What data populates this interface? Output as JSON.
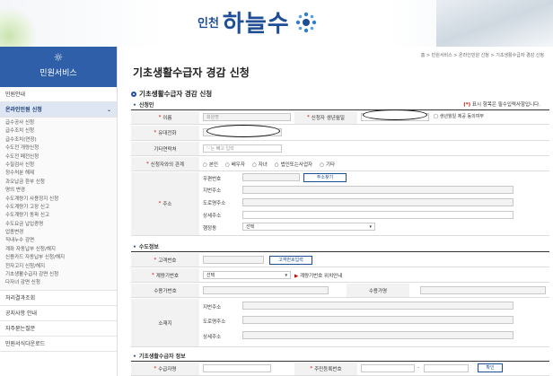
{
  "header": {
    "logo_small": "인천",
    "logo_big": "하늘수"
  },
  "sidebar": {
    "title": "민원서비스",
    "items": [
      {
        "label": "민원안내"
      },
      {
        "label": "온라인민원 신청",
        "icon": "chevron-down-icon"
      },
      {
        "label": "처리결과조회"
      },
      {
        "label": "공지사항 안내"
      },
      {
        "label": "자주묻는질문"
      },
      {
        "label": "민원서식다운로드"
      }
    ],
    "sub_items": [
      "급수공사 신청",
      "급수조치 신청",
      "급수조치(연장)",
      "수도전 개량신청",
      "수도전 폐전신청",
      "수질검사 신청",
      "정수처분 해제",
      "과오납금 환부 신청",
      "명의 변경",
      "수도계량기 사용정지 신청",
      "수도계량기 고장 신고",
      "수도계량기 동파 신고",
      "수도요금 납입증명",
      "업종변경",
      "직내누수 감면",
      "계좌 자동납부 신청/해지",
      "신용카드 자동납부 신청/해지",
      "전자고지 신청/해지",
      "기초생활수급자 감면 신청",
      "다자녀 감면 신청"
    ]
  },
  "breadcrumb": "홈 > 민원서비스 > 온라인민원 신청 > 기초생활수급자 경감 신청",
  "page_title": "기초생활수급자 경감 신청",
  "section_title": "기초생활수급자 경감 신청",
  "required_note": {
    "mark": "(*)",
    "text": " 표시 항목은 필수입력사항입니다."
  },
  "applicant": {
    "header": "신청인",
    "name_label": "이름",
    "name_value": "회원명",
    "birth_label": "신청자 생년월일",
    "birth_consent": "생년월일 제공 동의여부",
    "phone_label": "유대전화",
    "other_label": "기타연락처",
    "other_placeholder": "'-'는 빼고 입력",
    "relation_label": "신청자와의 관계",
    "relation_options": [
      "본인",
      "배우자",
      "자녀",
      "법인또는사업자",
      "기타"
    ],
    "addr_label": "주소",
    "zip_label": "우편번호",
    "zip_button": "주소찾기",
    "jibun_label": "지번주소",
    "road_label": "도로명주소",
    "detail_label": "상세주소",
    "dong_label": "행정동",
    "dong_value": "선택"
  },
  "water": {
    "header": "수도정보",
    "cust_label": "고객번호",
    "cust_button": "고객번호입력",
    "meter_label": "계량기번호",
    "meter_value": "선택",
    "meter_note": "계량기번호 위치안내",
    "user_no_label": "수용가번호",
    "user_type_label": "수용가명",
    "loc_label": "소재지",
    "jibun_label": "지번주소",
    "road_label": "도로명주소",
    "detail_label": "상세주소"
  },
  "recipient": {
    "header": "기초생활수급자 정보",
    "name_label": "수급자명",
    "id_label": "주민등록번호",
    "confirm_button": "확인"
  }
}
